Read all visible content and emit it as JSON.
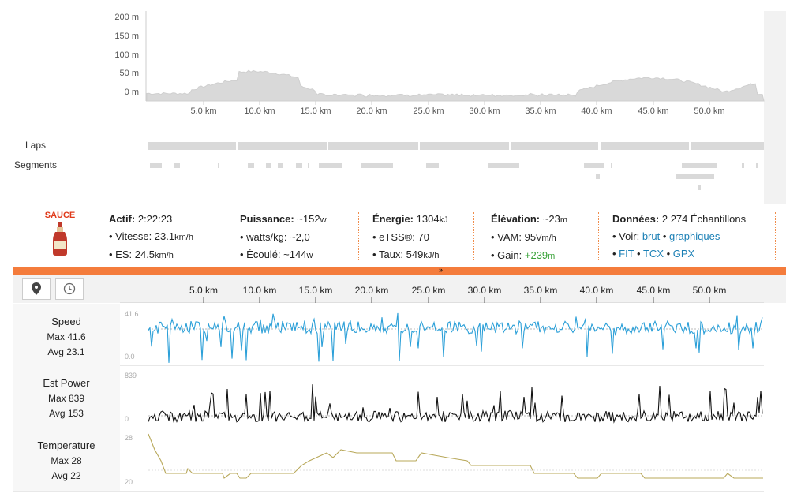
{
  "elevation": {
    "y_ticks": [
      "200 m",
      "150 m",
      "100 m",
      "50 m",
      "0 m"
    ],
    "x_ticks": [
      "5.0 km",
      "10.0 km",
      "15.0 km",
      "20.0 km",
      "25.0 km",
      "30.0 km",
      "35.0 km",
      "40.0 km",
      "45.0 km",
      "50.0 km"
    ]
  },
  "rows": {
    "laps": "Laps",
    "segments": "Segments"
  },
  "stats": {
    "logo_text": "SAUCE",
    "active": {
      "label": "Actif:",
      "value": "2:22:23",
      "items": [
        {
          "text": "Vitesse: 23.1",
          "unit": "km/h"
        },
        {
          "text": "ES: 24.5",
          "unit": "km/h"
        }
      ]
    },
    "power": {
      "label": "Puissance:",
      "value": "~152",
      "unit": "w",
      "items": [
        {
          "text": "watts/kg: ~2,0",
          "unit": ""
        },
        {
          "text": "Écoulé: ~144",
          "unit": "w"
        }
      ]
    },
    "energy": {
      "label": "Énergie:",
      "value": "1304",
      "unit": "kJ",
      "items": [
        {
          "text": "eTSS®: 70",
          "unit": ""
        },
        {
          "text": "Taux: 549",
          "unit": "kJ/h"
        }
      ]
    },
    "elevation": {
      "label": "Élévation:",
      "value": "~23",
      "unit": "m",
      "items": [
        {
          "text": "VAM: 95",
          "unit": "Vm/h"
        },
        {
          "text": "Gain:",
          "value": "+239",
          "unit": "m"
        }
      ]
    },
    "data": {
      "label": "Données:",
      "value": "2 274 Échantillons",
      "voir_label": "Voir:",
      "brut": "brut",
      "graphiques": "graphiques",
      "fit": "FIT",
      "tcx": "TCX",
      "gpx": "GPX"
    }
  },
  "lower": {
    "x_ticks": [
      "5.0 km",
      "10.0 km",
      "15.0 km",
      "20.0 km",
      "25.0 km",
      "30.0 km",
      "35.0 km",
      "40.0 km",
      "45.0 km",
      "50.0 km"
    ],
    "charts": [
      {
        "name": "Speed",
        "max": "Max 41.6",
        "avg": "Avg 23.1",
        "top": "41.6",
        "bottom": "0.0",
        "color": "#2a9fd8"
      },
      {
        "name": "Est Power",
        "max": "Max 839",
        "avg": "Avg 153",
        "top": "839",
        "bottom": "0",
        "color": "#111111"
      },
      {
        "name": "Temperature",
        "max": "Max 28",
        "avg": "Avg 22",
        "top": "28",
        "bottom": "20",
        "color": "#b8a85a"
      }
    ]
  }
}
